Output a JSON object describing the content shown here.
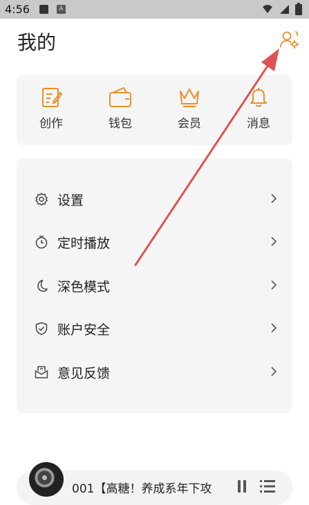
{
  "status_bar": {
    "time": "4:56",
    "notification_badge": "A"
  },
  "header": {
    "title": "我的",
    "profile_settings_icon": "user-gear-icon"
  },
  "quick_actions": [
    {
      "label": "创作",
      "icon": "edit-icon"
    },
    {
      "label": "钱包",
      "icon": "wallet-icon"
    },
    {
      "label": "会员",
      "icon": "crown-icon"
    },
    {
      "label": "消息",
      "icon": "bell-icon"
    }
  ],
  "menu": [
    {
      "label": "设置",
      "icon": "gear-icon"
    },
    {
      "label": "定时播放",
      "icon": "timer-icon"
    },
    {
      "label": "深色模式",
      "icon": "moon-icon"
    },
    {
      "label": "账户安全",
      "icon": "shield-icon"
    },
    {
      "label": "意见反馈",
      "icon": "feedback-icon"
    }
  ],
  "player": {
    "title": "001【高糖！养成系年下攻"
  },
  "colors": {
    "accent": "#e8902a",
    "annotation_arrow": "#e05252",
    "card_bg": "#f5f5f5"
  }
}
